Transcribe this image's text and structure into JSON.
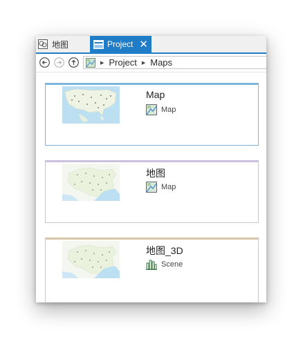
{
  "tabs": [
    {
      "label": "地图",
      "icon": "map-frame-icon",
      "active": false
    },
    {
      "label": "Project",
      "icon": "catalog-pane-icon",
      "active": true,
      "close": "✕"
    }
  ],
  "breadcrumb": {
    "root_icon": "folder-map-icon",
    "items": [
      "Project",
      "Maps"
    ]
  },
  "items": [
    {
      "title": "Map",
      "type": "Map",
      "type_icon": "map-icon",
      "accent": "#7ab6dd",
      "selected": true
    },
    {
      "title": "地图",
      "type": "Map",
      "type_icon": "map-icon",
      "accent": "#c8c0dc",
      "selected": false
    },
    {
      "title": "地图_3D",
      "type": "Scene",
      "type_icon": "scene-icon",
      "accent": "#d8c4a6",
      "selected": false
    }
  ],
  "colors": {
    "accent": "#1f7cc6"
  }
}
